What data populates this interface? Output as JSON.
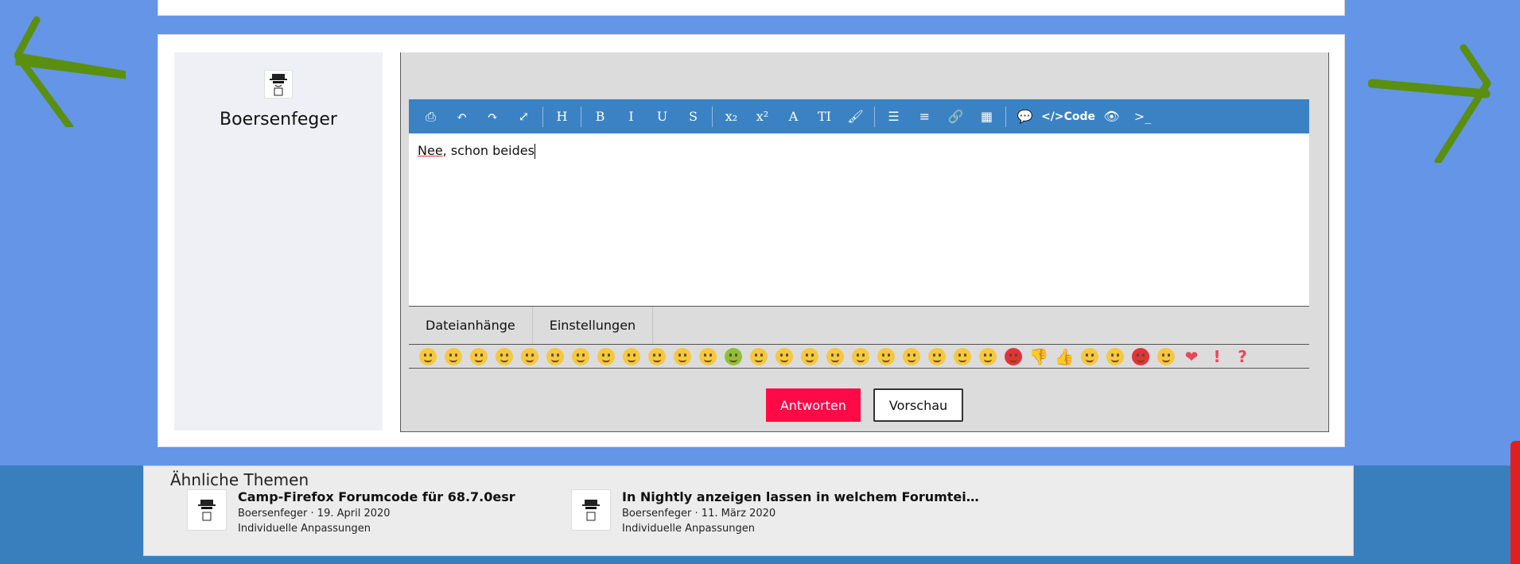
{
  "user": {
    "name": "Boersenfeger",
    "avatar_icon": "spy-avatar-icon"
  },
  "toolbar": {
    "items": [
      {
        "icon": "source-icon",
        "glyph": "⎙"
      },
      {
        "icon": "undo-icon",
        "glyph": "↶"
      },
      {
        "icon": "redo-icon",
        "glyph": "↷"
      },
      {
        "icon": "fullscreen-icon",
        "glyph": "⤢"
      },
      {
        "sep": true
      },
      {
        "icon": "heading-icon",
        "glyph": "H"
      },
      {
        "sep": true
      },
      {
        "icon": "bold-icon",
        "glyph": "B"
      },
      {
        "icon": "italic-icon",
        "glyph": "I"
      },
      {
        "icon": "underline-icon",
        "glyph": "U"
      },
      {
        "icon": "strikethrough-icon",
        "glyph": "S"
      },
      {
        "sep": true
      },
      {
        "icon": "subscript-icon",
        "glyph": "x₂"
      },
      {
        "icon": "superscript-icon",
        "glyph": "x²"
      },
      {
        "icon": "font-icon",
        "glyph": "A"
      },
      {
        "icon": "font-size-icon",
        "glyph": "TI"
      },
      {
        "icon": "brush-icon",
        "glyph": "🖌"
      },
      {
        "sep": true
      },
      {
        "icon": "list-icon",
        "glyph": "☰"
      },
      {
        "icon": "align-icon",
        "glyph": "≡"
      },
      {
        "icon": "link-icon",
        "glyph": "🔗"
      },
      {
        "icon": "table-icon",
        "glyph": "▦"
      },
      {
        "sep": true
      },
      {
        "icon": "quote-icon",
        "glyph": "💬"
      },
      {
        "icon": "code-icon",
        "glyph": "</>Code",
        "code": true
      },
      {
        "icon": "spoiler-icon",
        "glyph": "👁"
      },
      {
        "icon": "inline-code-icon",
        "glyph": ">_"
      }
    ]
  },
  "editor": {
    "text_word1": "Nee",
    "text_rest": ", schon beides"
  },
  "tabs": {
    "attachments": "Dateianhänge",
    "settings": "Einstellungen"
  },
  "smileys": [
    "smile",
    "sad",
    "wink",
    "tongue",
    "grin",
    "laugh",
    "cry",
    "angry",
    "kiss",
    "neutral",
    "tongue2",
    "shocked",
    "sick",
    "squint",
    "thinking",
    "upside",
    "unamused",
    "cool",
    "confused",
    "surprised",
    "rolleyes",
    "hearteyes",
    "astonished",
    "mad",
    "thumbsdown",
    "thumbsup",
    "sleepy",
    "whistle",
    "devil",
    "angel",
    "heart",
    "exclamation",
    "question"
  ],
  "buttons": {
    "reply": "Antworten",
    "preview": "Vorschau"
  },
  "similar": {
    "title": "Ähnliche Themen",
    "threads": [
      {
        "title": "Camp-Firefox Forumcode für 68.7.0esr",
        "meta": "Boersenfeger · 19. April 2020",
        "forum": "Individuelle Anpassungen"
      },
      {
        "title": "In Nightly anzeigen lassen in welchem Forumtei…",
        "meta": "Boersenfeger · 11. März 2020",
        "forum": "Individuelle Anpassungen"
      }
    ]
  },
  "colors": {
    "background": "#6495e6",
    "toolbar": "#3b82c4",
    "reply_button": "#ff0a47",
    "arrow": "#5a8f0f"
  }
}
